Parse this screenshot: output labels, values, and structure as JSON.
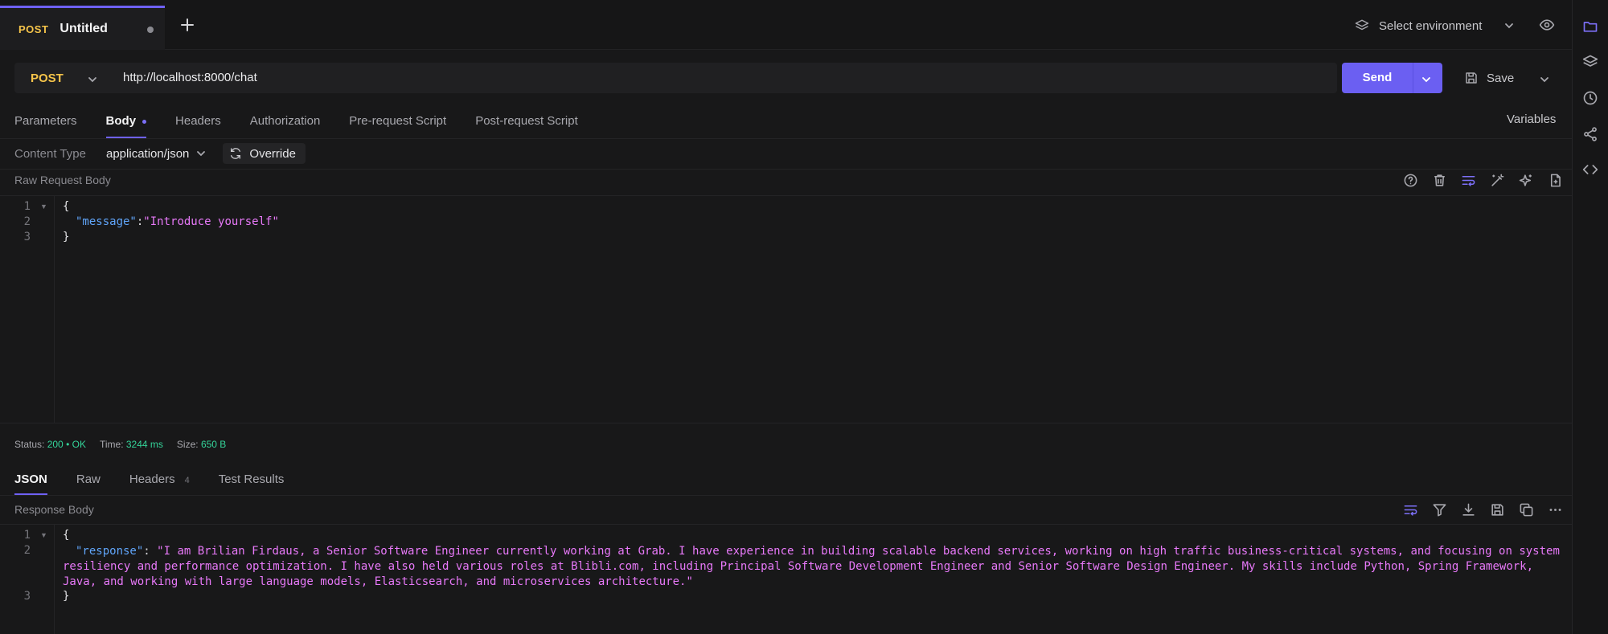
{
  "tab": {
    "method": "POST",
    "name": "Untitled"
  },
  "environment": {
    "label": "Select environment"
  },
  "request": {
    "method": "POST",
    "url": "http://localhost:8000/chat",
    "send_label": "Send",
    "save_label": "Save"
  },
  "request_tabs": {
    "parameters": "Parameters",
    "body": "Body",
    "headers": "Headers",
    "authorization": "Authorization",
    "pre_request": "Pre-request Script",
    "post_request": "Post-request Script",
    "variables": "Variables"
  },
  "content_type": {
    "label": "Content Type",
    "value": "application/json",
    "override_label": "Override"
  },
  "request_body": {
    "label": "Raw Request Body",
    "line_numbers": [
      "1",
      "2",
      "3"
    ],
    "open_brace": "{",
    "key": "\"message\"",
    "colon": ":",
    "value": "\"Introduce yourself\"",
    "close_brace": "}"
  },
  "status": {
    "status_label": "Status:",
    "code": "200",
    "separator": "•",
    "text": "OK",
    "time_label": "Time:",
    "time": "3244 ms",
    "size_label": "Size:",
    "size": "650 B"
  },
  "response_tabs": {
    "json": "JSON",
    "raw": "Raw",
    "headers": "Headers",
    "headers_count": "4",
    "test_results": "Test Results"
  },
  "response_body": {
    "label": "Response Body",
    "line_numbers": [
      "1",
      "2",
      "3"
    ],
    "open_brace": "{",
    "key": "\"response\"",
    "colon": ": ",
    "value": "\"I am Brilian Firdaus, a Senior Software Engineer currently working at Grab. I have experience in building scalable backend services, working on high traffic business-critical systems, and focusing on system resiliency and performance optimization. I have also held various roles at Blibli.com, including Principal Software Development Engineer and Senior Software Design Engineer. My skills include Python, Spring Framework, Java, and working with large language models, Elasticsearch, and microservices architecture.\"",
    "close_brace": "}"
  },
  "colors": {
    "accent": "#6b5ff2",
    "method": "#f5c44a",
    "success": "#34d399",
    "json_key": "#60a5fa",
    "json_string": "#e879f9"
  }
}
